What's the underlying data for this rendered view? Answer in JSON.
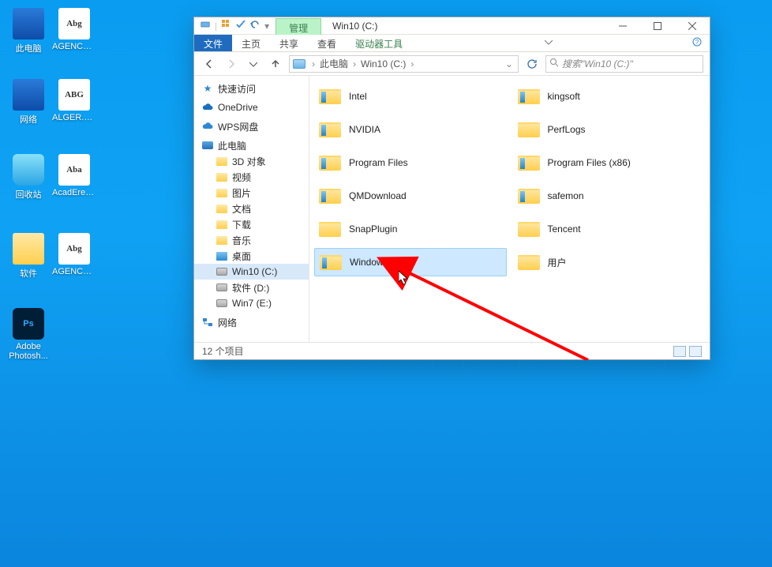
{
  "desktop_icons": {
    "this_pc": "此电脑",
    "agencyr": "AGENCYR...",
    "network": "网络",
    "alger": "ALGER.TTF",
    "recycle": "回收站",
    "acaderef": "AcadEref.ttf",
    "soft": "软件",
    "agencyb": "AGENCYB...",
    "ps_line1": "Adobe",
    "ps_line2": "Photosh...",
    "thumb_abg_upper": "Abg",
    "thumb_abg_caps": "ABG",
    "thumb_aba": "Aba",
    "thumb_ps": "Ps"
  },
  "window": {
    "manage_tab": "管理",
    "title": "Win10 (C:)",
    "ribbon": {
      "file": "文件",
      "home": "主页",
      "share": "共享",
      "view": "查看",
      "drive_tools": "驱动器工具"
    },
    "breadcrumbs": {
      "this_pc": "此电脑",
      "drive": "Win10 (C:)"
    },
    "search_placeholder": "搜索\"Win10 (C:)\"",
    "sidebar": {
      "quick_access": "快速访问",
      "onedrive": "OneDrive",
      "wps": "WPS网盘",
      "this_pc": "此电脑",
      "children": {
        "3d": "3D 对象",
        "video": "视频",
        "pictures": "图片",
        "documents": "文档",
        "downloads": "下载",
        "music": "音乐",
        "desktop": "桌面",
        "c": "Win10 (C:)",
        "d": "软件 (D:)",
        "e": "Win7 (E:)"
      },
      "network": "网络"
    },
    "folders": {
      "intel": "Intel",
      "kingsoft": "kingsoft",
      "nvidia": "NVIDIA",
      "perflogs": "PerfLogs",
      "program_files": "Program Files",
      "program_files_x86": "Program Files (x86)",
      "qmdownload": "QMDownload",
      "safemon": "safemon",
      "snapplugin": "SnapPlugin",
      "tencent": "Tencent",
      "windows": "Windows",
      "users": "用户"
    },
    "status": "12 个项目"
  }
}
